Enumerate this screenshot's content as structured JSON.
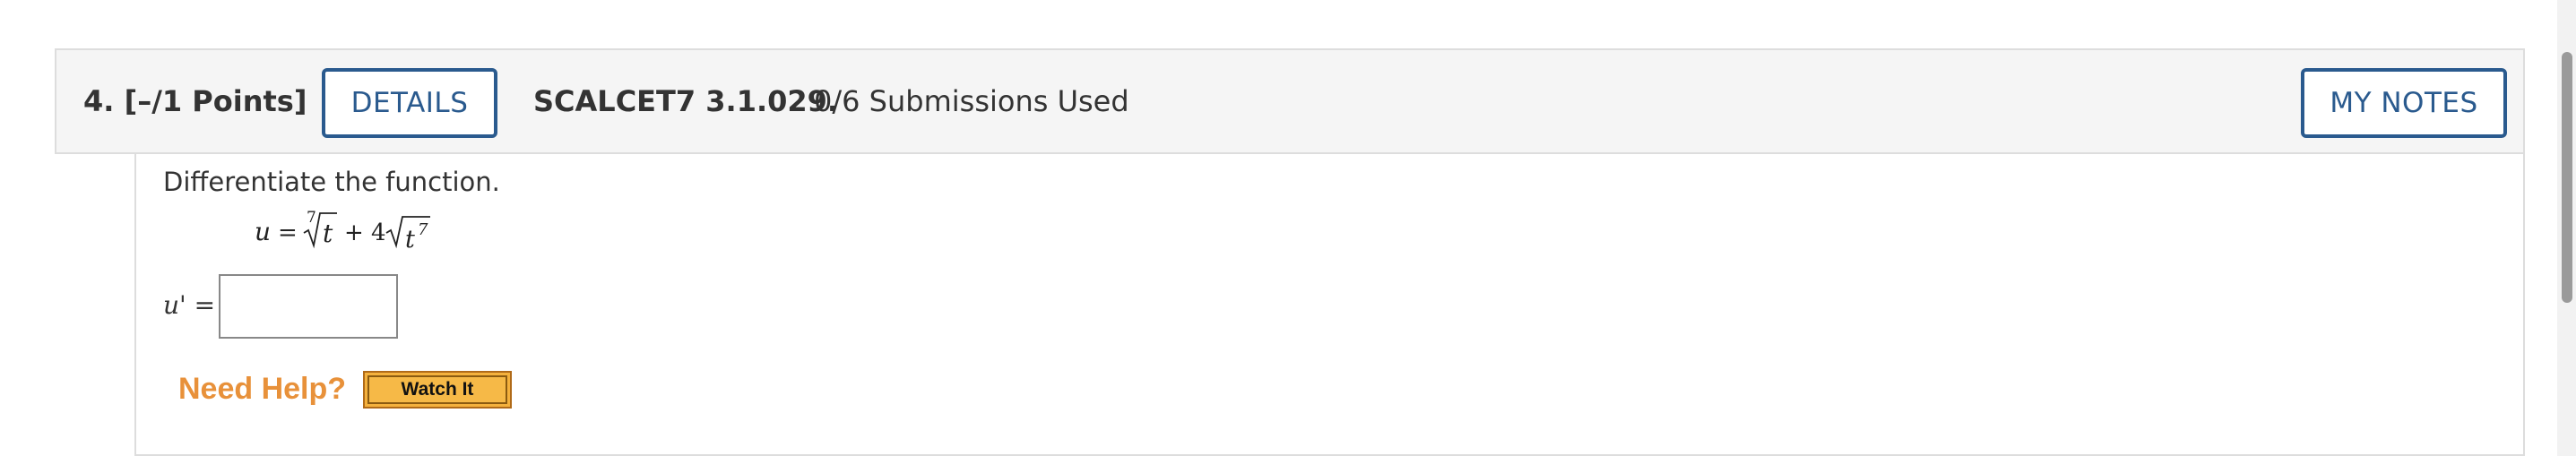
{
  "question": {
    "number_label": "4.  [–/1 Points]",
    "details_label": "DETAILS",
    "problem_code": "SCALCET7 3.1.029.",
    "submissions": "0/6 Submissions Used",
    "my_notes_label": "MY NOTES"
  },
  "body": {
    "instruction": "Differentiate the function.",
    "equation": {
      "lhs": "u",
      "equals": "=",
      "root1_index": "7",
      "root1_radicand": "t",
      "plus": "+",
      "coefficient": "4",
      "root2_base": "t",
      "root2_exponent": "7"
    },
    "answer_label": "u' =",
    "answer_value": "",
    "need_help": "Need Help?",
    "watch_it": "Watch It"
  },
  "colors": {
    "header_bg": "#f5f5f5",
    "button_blue": "#2a5a8e",
    "need_help_orange": "#e8913a",
    "watch_it_gold": "#f4b13d"
  },
  "icons": {
    "scrollbar": "vertical-scrollbar"
  }
}
